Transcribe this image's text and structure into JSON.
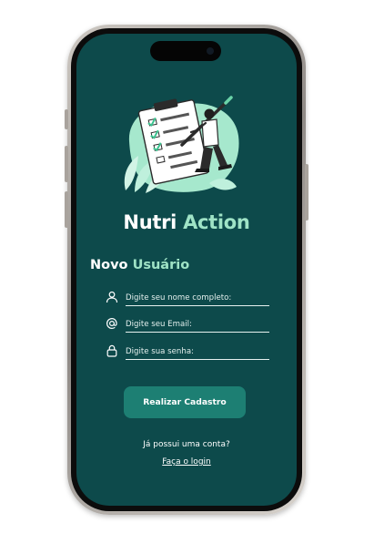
{
  "app": {
    "title_part1": "Nutri ",
    "title_part2": "Action"
  },
  "form": {
    "heading_part1": "Novo ",
    "heading_part2": "Usuário",
    "fields": [
      {
        "icon": "user-icon",
        "placeholder": "Digite seu nome completo:"
      },
      {
        "icon": "at-sign-icon",
        "placeholder": "Digite seu Email:"
      },
      {
        "icon": "lock-icon",
        "placeholder": "Digite sua senha:"
      }
    ],
    "submit_label": "Realizar Cadastro"
  },
  "footer": {
    "has_account_text": "Já possui uma conta?",
    "login_link": "Faça o login"
  },
  "colors": {
    "screen_background": "#0d4a4b",
    "accent_mint": "#9fe3c6",
    "button": "#1d7f73",
    "text": "#ffffff"
  }
}
